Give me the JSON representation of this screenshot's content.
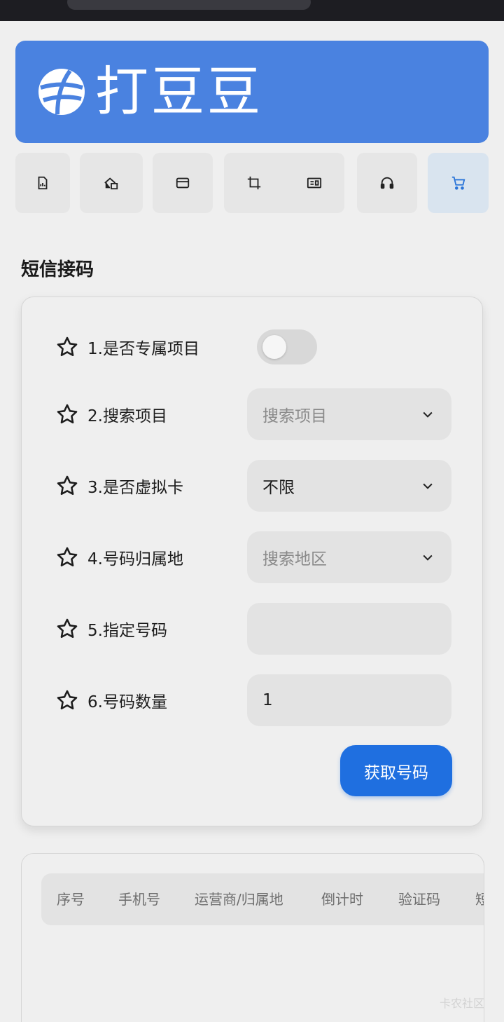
{
  "brand": {
    "title": "打豆豆",
    "color": "#4a82e0"
  },
  "nav": {
    "items": [
      {
        "icon": "document-chart-icon"
      },
      {
        "icon": "home-switch-icon"
      },
      {
        "icon": "wallet-icon"
      },
      {
        "icon": "crop-icon"
      },
      {
        "icon": "id-card-icon"
      },
      {
        "icon": "headset-icon"
      },
      {
        "icon": "cart-icon",
        "active": true
      }
    ],
    "active_color": "#2a74d8"
  },
  "section": {
    "title": "短信接码"
  },
  "form": {
    "exclusive_label": "1.是否专属项目",
    "exclusive_on": false,
    "project_label": "2.搜索项目",
    "project_placeholder": "搜索项目",
    "virtual_label": "3.是否虚拟卡",
    "virtual_value": "不限",
    "region_label": "4.号码归属地",
    "region_placeholder": "搜索地区",
    "number_label": "5.指定号码",
    "number_value": "",
    "count_label": "6.号码数量",
    "count_value": "1",
    "submit_label": "获取号码",
    "accent": "#1f6fe0"
  },
  "table": {
    "headers": [
      "序号",
      "手机号",
      "运营商/归属地",
      "倒计时",
      "验证码",
      "短"
    ]
  },
  "watermark": "卡农社区"
}
